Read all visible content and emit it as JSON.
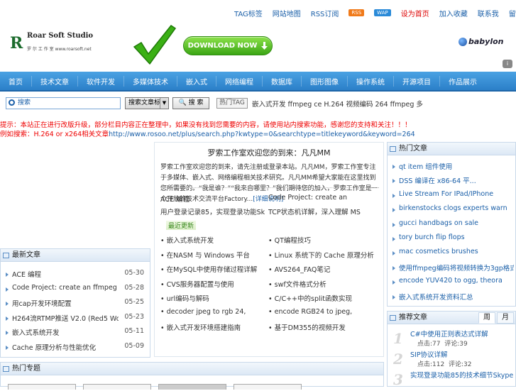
{
  "topnav": {
    "items": [
      "TAG标签",
      "网站地图",
      "RSS订阅"
    ],
    "rss_badge": "RSS",
    "wap_badge": "WAP",
    "red_link": "设为首页",
    "items2": [
      "加入收藏",
      "联系我",
      "留言板"
    ]
  },
  "header": {
    "logo_title": "Roar Soft Studio",
    "logo_sub": "罗 尔 工 作 室 www.roarsoft.net",
    "download_label": "DOWNLOAD NOW",
    "babylon_label": "babylon",
    "info_icon": "i"
  },
  "mainnav": {
    "items": [
      "首页",
      "技术文章",
      "软件开发",
      "多媒体技术",
      "嵌入式",
      "网络编程",
      "数据库",
      "图形图像",
      "操作系统",
      "开源项目",
      "作品展示"
    ]
  },
  "search": {
    "placeholder": "搜索",
    "select_value": "搜索文章标题",
    "button_label": "搜 索",
    "hot_tag_label": "热门TAG",
    "tags": "嵌入式开发 ffmpeg ce H.264 视频编码 264 ffmpeg 多"
  },
  "notice": {
    "line1": "提示：本站正在进行改版升级，部分栏目内容正在整理中，如果没有找到您需要的内容，请使用站内搜索功能，感谢您的支持和关注！！！",
    "line2_prefix": "例如搜索：H.264 or x264相关文章",
    "line2_url": "http://www.rosoo.net/plus/search.php?kwtype=0&searchtype=titlekeyword&keyword=264"
  },
  "center": {
    "title": "罗索工作室欢迎您的到来：凡凡MM",
    "desc": "罗索工作室欢迎您的到来，请先注册或登录本站。凡凡MM，罗索工作室专注于多媒体、嵌入式、网络编程相关技术研究。凡凡MM希望大家能在这里找到您所需要的。“我是谁？”“我来自哪里？”我们期待您的加入，罗索工作室是一个开放的技术交流平台Factory...",
    "more": "[详细说明]",
    "links": [
      [
        "ACE 编程",
        "Code Project: create an"
      ],
      [
        "用户登录记录85，实现登录功能Sk",
        "TCP状态机详解，深入理解 MS"
      ]
    ],
    "recent_label": "最近更新",
    "recent": [
      [
        "嵌入式系统开发",
        "QT编程技巧"
      ],
      [
        "在NASM 与 Windows 平台",
        "Linux 系统下的 Cache 原理分析"
      ],
      [
        "在MySQL中使用存储过程详解",
        "AVS264_FAQ笔记"
      ],
      [
        "CVS服务器配置与使用",
        "swf文件格式分析"
      ],
      [
        "url编码与解码",
        "C/C++中的split函数实现"
      ],
      [
        "decoder jpeg to rgb 24,",
        "encode RGB24 to jpeg,"
      ],
      [
        "嵌入式开发环境搭建指南",
        "基于DM355的视频开发"
      ]
    ]
  },
  "left_recent": {
    "title": "最新文章",
    "items": [
      {
        "t": "ACE 编程",
        "d": "05-30"
      },
      {
        "t": "Code Project: create an ffmpeg",
        "d": "05-28"
      },
      {
        "t": "用cap开发环境配置",
        "d": "05-25"
      },
      {
        "t": "H264流RTMP推送 V2.0 (Red5 Wo",
        "d": "05-23"
      },
      {
        "t": "嵌入式系统开发",
        "d": "05-11"
      },
      {
        "t": "Cache 原理分析与性能优化",
        "d": "05-09"
      }
    ]
  },
  "right_hot": {
    "title": "热门文章",
    "items": [
      "qt item 组件使用",
      "DSS 编译在 x86-64 平...",
      "Live Stream For IPad/IPhone",
      "birkenstocks clogs experts warn",
      "gucci handbags on sale",
      "tory burch flip flops",
      "mac cosmetics brushes",
      "使用ffmpeg编码将视频转换为3gp格式的方法",
      "encode YUV420 to ogg, theora",
      "嵌入式系统开发资料汇总"
    ]
  },
  "right_rank": {
    "title": "推荐文章",
    "tabs": [
      "周",
      "月"
    ],
    "items": [
      {
        "n": "1",
        "t": "C#中使用正则表达式详解",
        "v1": "点击:77",
        "v2": "评论:39"
      },
      {
        "n": "2",
        "t": "SIP协议详解",
        "v1": "点击:112",
        "v2": "评论:32"
      },
      {
        "n": "3",
        "t": "实现登录功能85的技术细节Skype",
        "v1": "",
        "v2": ""
      }
    ]
  },
  "left_bottom": {
    "title": "热门专题"
  }
}
